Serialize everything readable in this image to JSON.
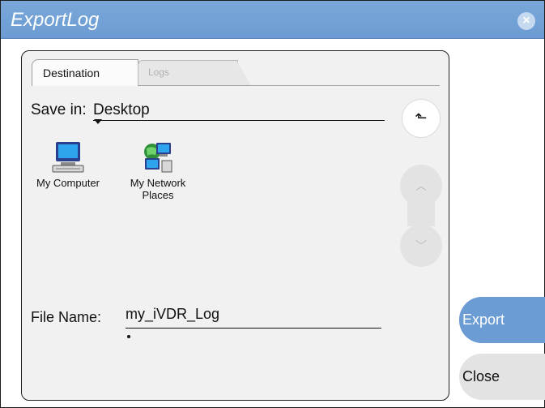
{
  "window": {
    "title": "ExportLog",
    "close_icon": "close-icon"
  },
  "tabs": [
    {
      "label": "Destination",
      "active": true
    },
    {
      "label": "Logs",
      "active": false
    }
  ],
  "save_in": {
    "label": "Save in:",
    "value": "Desktop"
  },
  "files": [
    {
      "label_line1": "My Computer",
      "label_line2": "",
      "icon": "computer-icon"
    },
    {
      "label_line1": "My Network",
      "label_line2": "Places",
      "icon": "network-places-icon"
    }
  ],
  "up_button": {
    "icon": "up-folder-icon",
    "glyph": "⬑"
  },
  "scroll": {
    "up_glyph": "︿",
    "down_glyph": "﹀"
  },
  "file_name": {
    "label": "File Name:",
    "value": "my_iVDR_Log"
  },
  "buttons": {
    "export": "Export",
    "close": "Close"
  },
  "colors": {
    "accent": "#6b9cd3",
    "panel_bg": "#f1f1f1",
    "disabled": "#e3e3e3"
  }
}
